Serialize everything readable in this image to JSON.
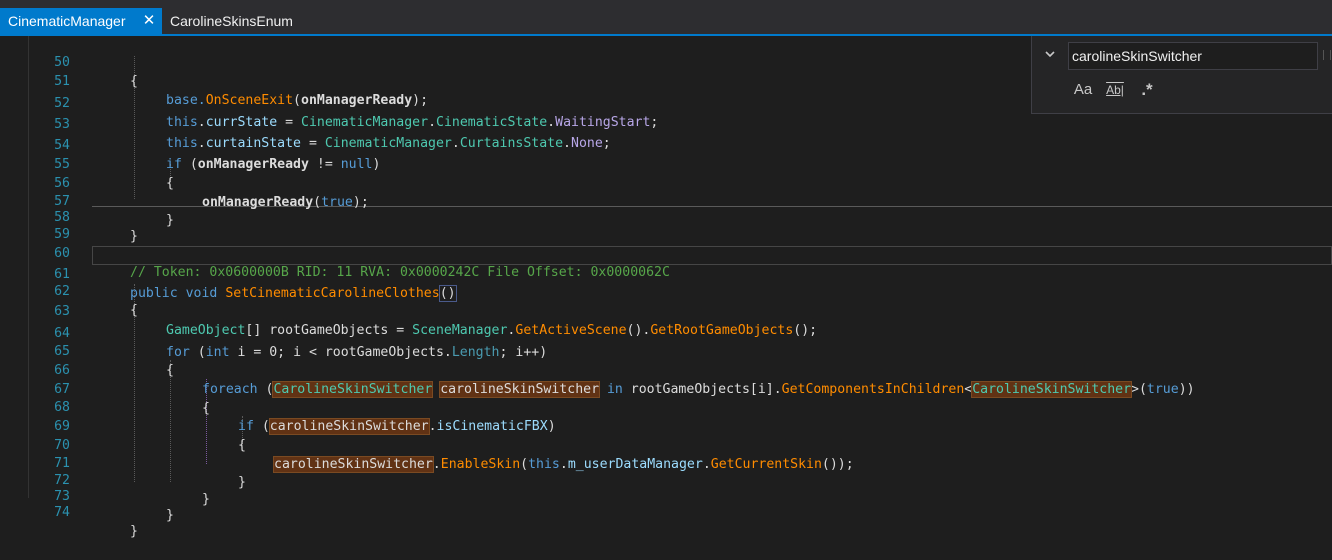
{
  "tabs": [
    {
      "label": "CinematicManager",
      "active": true,
      "close_icon": "close-icon"
    },
    {
      "label": "CarolineSkinsEnum",
      "active": false
    }
  ],
  "find_panel": {
    "search_value": "carolineSkinSwitcher",
    "match_case_icon": "Aa",
    "whole_word_icon": "Ab|",
    "regex_icon": ".*",
    "expand_icon": "chevron-down-icon"
  },
  "colors": {
    "accent": "#007acc",
    "editor_bg": "#1e1e1e",
    "highlight": "#613214",
    "line_number": "#2b91af"
  },
  "editor": {
    "line_numbers": [
      "50",
      "51",
      "52",
      "53",
      "54",
      "55",
      "56",
      "57",
      "58",
      "59",
      "60",
      "61",
      "62",
      "63",
      "64",
      "65",
      "66",
      "67",
      "68",
      "69",
      "70",
      "71",
      "72",
      "73",
      "74"
    ],
    "code": {
      "l50": "{",
      "l51_a": "base.",
      "l51_b": "OnSceneExit",
      "l51_c": "(",
      "l51_d": "onManagerReady",
      "l51_e": ");",
      "l52_a": "this",
      "l52_b": ".",
      "l52_c": "currState",
      "l52_d": " = ",
      "l52_e": "CinematicManager",
      "l52_f": ".",
      "l52_g": "CinematicState",
      "l52_h": ".",
      "l52_i": "WaitingStart",
      "l52_j": ";",
      "l53_a": "this",
      "l53_b": ".",
      "l53_c": "curtainState",
      "l53_d": " = ",
      "l53_e": "CinematicManager",
      "l53_f": ".",
      "l53_g": "CurtainsState",
      "l53_h": ".",
      "l53_i": "None",
      "l53_j": ";",
      "l54_a": "if",
      "l54_b": " (",
      "l54_c": "onManagerReady",
      "l54_d": " != ",
      "l54_e": "null",
      "l54_f": ")",
      "l55": "{",
      "l56_a": "onManagerReady",
      "l56_b": "(",
      "l56_c": "true",
      "l56_d": ");",
      "l57": "}",
      "l58": "}",
      "l60": "// Token: 0x0600000B RID: 11 RVA: 0x0000242C File Offset: 0x0000062C",
      "l61_a": "public",
      "l61_b": " ",
      "l61_c": "void",
      "l61_d": " ",
      "l61_e": "SetCinematicCarolineClothes",
      "l61_f": "()",
      "l62": "{",
      "l63_a": "GameObject",
      "l63_b": "[] rootGameObjects = ",
      "l63_c": "SceneManager",
      "l63_d": ".",
      "l63_e": "GetActiveScene",
      "l63_f": "().",
      "l63_g": "GetRootGameObjects",
      "l63_h": "();",
      "l64_a": "for",
      "l64_b": " (",
      "l64_c": "int",
      "l64_d": " i = 0; i < rootGameObjects.",
      "l64_e": "Length",
      "l64_f": "; i++)",
      "l65": "{",
      "l66_a": "foreach",
      "l66_b": " (",
      "l66_c": "CarolineSkinSwitcher",
      "l66_d": " ",
      "l66_e": "carolineSkinSwitcher",
      "l66_f": " ",
      "l66_g": "in",
      "l66_h": " rootGameObjects[i].",
      "l66_i": "GetComponentsInChildren",
      "l66_j": "<",
      "l66_k": "CarolineSkinSwitcher",
      "l66_l": ">(",
      "l66_m": "true",
      "l66_n": "))",
      "l67": "{",
      "l68_a": "if",
      "l68_b": " (",
      "l68_c": "carolineSkinSwitcher",
      "l68_d": ".",
      "l68_e": "isCinematicFBX",
      "l68_f": ")",
      "l69": "{",
      "l70_a": "carolineSkinSwitcher",
      "l70_b": ".",
      "l70_c": "EnableSkin",
      "l70_d": "(",
      "l70_e": "this",
      "l70_f": ".",
      "l70_g": "m_userDataManager",
      "l70_h": ".",
      "l70_i": "GetCurrentSkin",
      "l70_j": "());",
      "l71": "}",
      "l72": "}",
      "l73": "}",
      "l74": "}"
    }
  }
}
